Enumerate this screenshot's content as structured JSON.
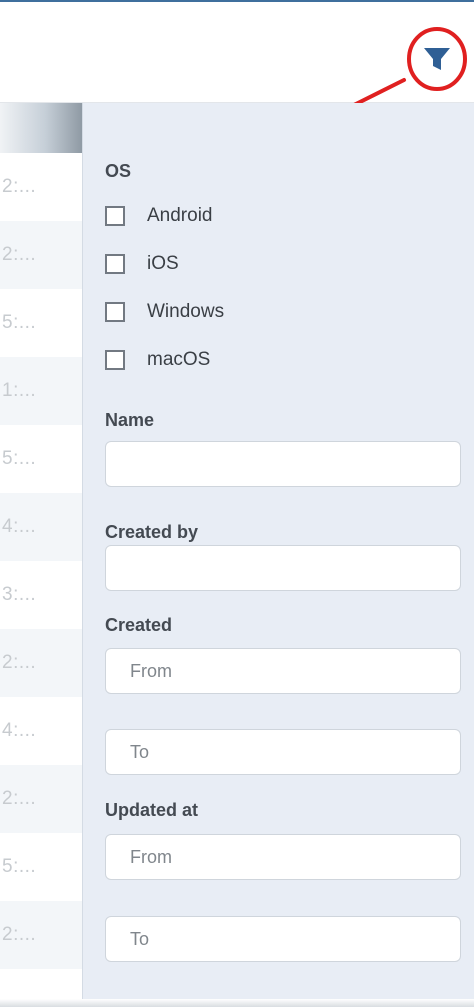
{
  "table": {
    "rows": [
      "2:...",
      "2:...",
      "5:...",
      "1:...",
      "5:...",
      "4:...",
      "3:...",
      "2:...",
      "4:...",
      "2:...",
      "5:...",
      "2:..."
    ]
  },
  "filter": {
    "button_icon": "funnel-icon",
    "os_label": "OS",
    "os_options": [
      "Android",
      "iOS",
      "Windows",
      "macOS"
    ],
    "name_label": "Name",
    "name_value": "",
    "created_by_label": "Created by",
    "created_by_value": "",
    "created_label": "Created",
    "created_from_placeholder": "From",
    "created_to_placeholder": "To",
    "updated_label": "Updated at",
    "updated_from_placeholder": "From",
    "updated_to_placeholder": "To"
  },
  "colors": {
    "accent": "#2f5f95",
    "annotation": "#e02020",
    "panel_background": "#e8edf5"
  }
}
